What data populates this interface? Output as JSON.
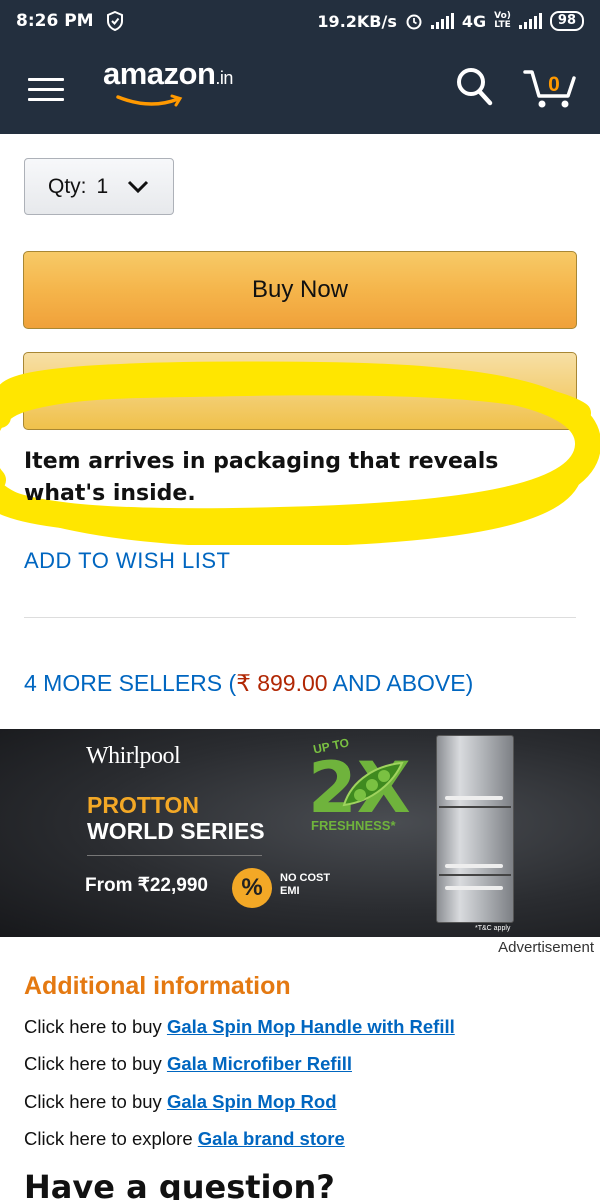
{
  "status_bar": {
    "time": "8:26 PM",
    "speed": "19.2KB/s",
    "network": "4G",
    "volte_top": "Vo)",
    "volte_bottom": "LTE",
    "battery": "98"
  },
  "header": {
    "logo_text": "amazon",
    "logo_suffix": ".in",
    "cart_count": "0"
  },
  "quantity": {
    "label": "Qty:",
    "value": "1"
  },
  "buttons": {
    "buy_now": "Buy Now"
  },
  "packaging_note": "Item arrives in packaging that reveals what's inside.",
  "wishlist_link": "ADD TO WISH LIST",
  "sellers": {
    "prefix": "4 MORE SELLERS (",
    "price": "₹ 899.00",
    "suffix": " AND ABOVE)"
  },
  "ad": {
    "brand": "Whirlpool",
    "line1": "PROTTON",
    "line2": "WORLD SERIES",
    "price": "From ₹22,990",
    "percent": "%",
    "emi": "NO COST EMI",
    "up_to": "UP TO",
    "two_x": "2X",
    "freshness": "FRESHNESS*",
    "tc": "*T&C apply",
    "label": "Advertisement"
  },
  "additional_info": {
    "title": "Additional information",
    "rows": [
      {
        "prefix": "Click here to buy ",
        "link": "Gala Spin Mop Handle with Refill"
      },
      {
        "prefix": "Click here to buy ",
        "link": "Gala Microfiber Refill"
      },
      {
        "prefix": "Click here to buy ",
        "link": "Gala Spin Mop Rod"
      },
      {
        "prefix": "Click here to explore ",
        "link": "Gala brand store"
      }
    ]
  },
  "question_heading": "Have a question?",
  "colors": {
    "header_bg": "#232f3e",
    "buy_now": "#f5b54b",
    "link": "#0066c0",
    "price": "#b12704",
    "section_title": "#e47911",
    "highlight": "#ffe600"
  }
}
